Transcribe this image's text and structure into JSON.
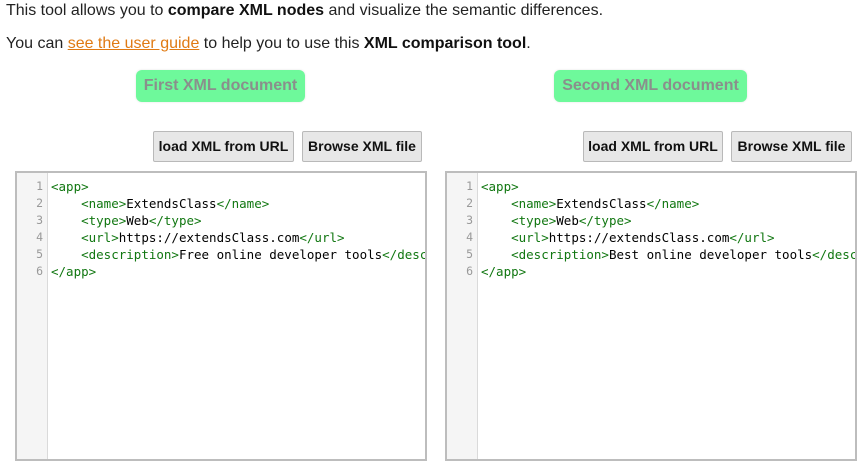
{
  "intro": {
    "line1_pre": "This tool allows you to ",
    "line1_bold": "compare XML nodes",
    "line1_post": " and visualize the semantic differences.",
    "line2_pre": "You can ",
    "line2_link": "see the user guide",
    "line2_mid": " to help you to use this ",
    "line2_bold": "XML comparison tool",
    "line2_post": "."
  },
  "panels": [
    {
      "title": "First XML document",
      "load_url_label": "load XML from URL",
      "browse_label": "Browse XML file",
      "lines": [
        {
          "num": "1",
          "indent": "",
          "open": "<app>",
          "text": "",
          "close": ""
        },
        {
          "num": "2",
          "indent": "    ",
          "open": "<name>",
          "text": "ExtendsClass",
          "close": "</name>"
        },
        {
          "num": "3",
          "indent": "    ",
          "open": "<type>",
          "text": "Web",
          "close": "</type>"
        },
        {
          "num": "4",
          "indent": "    ",
          "open": "<url>",
          "text": "https://extendsClass.com",
          "close": "</url>"
        },
        {
          "num": "5",
          "indent": "    ",
          "open": "<description>",
          "text": "Free online developer tools",
          "close": "</description>"
        },
        {
          "num": "6",
          "indent": "",
          "open": "</app>",
          "text": "",
          "close": ""
        }
      ]
    },
    {
      "title": "Second XML document",
      "load_url_label": "load XML from URL",
      "browse_label": "Browse XML file",
      "lines": [
        {
          "num": "1",
          "indent": "",
          "open": "<app>",
          "text": "",
          "close": ""
        },
        {
          "num": "2",
          "indent": "    ",
          "open": "<name>",
          "text": "ExtendsClass",
          "close": "</name>"
        },
        {
          "num": "3",
          "indent": "    ",
          "open": "<type>",
          "text": "Web",
          "close": "</type>"
        },
        {
          "num": "4",
          "indent": "    ",
          "open": "<url>",
          "text": "https://extendsClass.com",
          "close": "</url>"
        },
        {
          "num": "5",
          "indent": "    ",
          "open": "<description>",
          "text": "Best online developer tools",
          "close": "</description>"
        },
        {
          "num": "6",
          "indent": "",
          "open": "</app>",
          "text": "",
          "close": ""
        }
      ]
    }
  ],
  "colors": {
    "title_badge_bg": "#6ef99b",
    "title_badge_text": "#8a8f8c",
    "link": "#e07a13",
    "xml_tag": "#117711",
    "button_bg": "#e7e7e7"
  }
}
